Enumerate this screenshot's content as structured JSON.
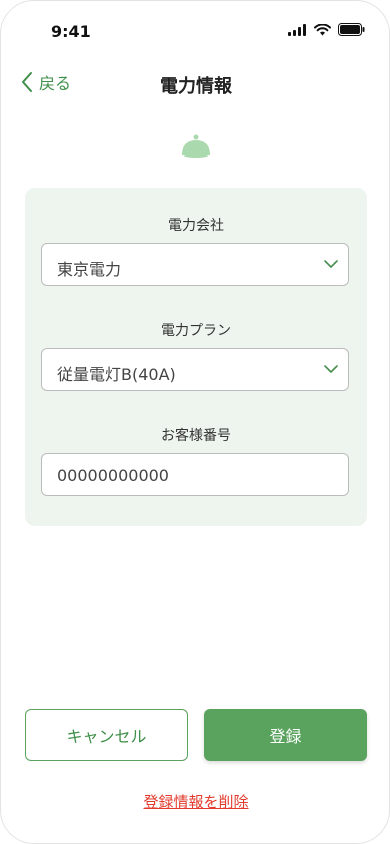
{
  "status": {
    "time": "9:41"
  },
  "nav": {
    "back_label": "戻る",
    "title": "電力情報"
  },
  "form": {
    "company": {
      "label": "電力会社",
      "value": "東京電力"
    },
    "plan": {
      "label": "電力プラン",
      "value": "従量電灯B(40A)"
    },
    "customer_number": {
      "label": "お客様番号",
      "value": "00000000000"
    }
  },
  "actions": {
    "cancel_label": "キャンセル",
    "register_label": "登録",
    "delete_label": "登録情報を削除"
  },
  "colors": {
    "accent": "#5aa35f",
    "card_bg": "#eef5ee",
    "danger": "#e23b2e",
    "icon_light": "#a9d9ad"
  }
}
